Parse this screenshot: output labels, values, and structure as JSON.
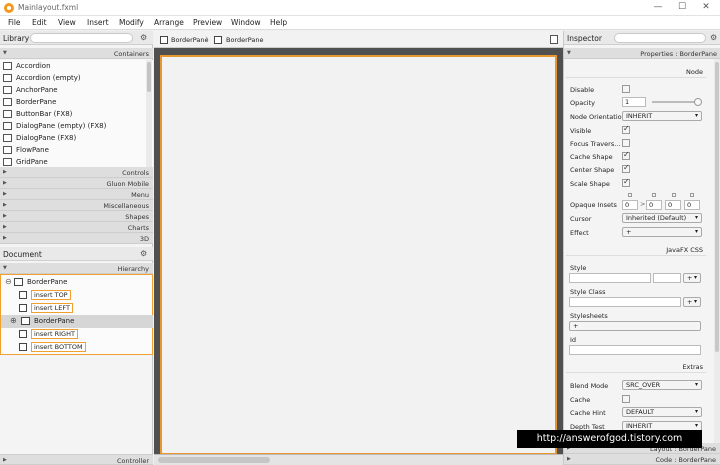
{
  "window": {
    "title": "Mainlayout.fxml",
    "minimize": "—",
    "maximize": "☐",
    "close": "✕"
  },
  "menu": [
    "File",
    "Edit",
    "View",
    "Insert",
    "Modify",
    "Arrange",
    "Preview",
    "Window",
    "Help"
  ],
  "library": {
    "title": "Library",
    "gear": "⚙",
    "containers_header": "Containers",
    "items": [
      "Accordion",
      "Accordion  (empty)",
      "AnchorPane",
      "BorderPane",
      "ButtonBar  (FX8)",
      "DialogPane (empty)  (FX8)",
      "DialogPane  (FX8)",
      "FlowPane",
      "GridPane"
    ],
    "sections": [
      "Controls",
      "Gluon Mobile",
      "Menu",
      "Miscellaneous",
      "Shapes",
      "Charts",
      "3D"
    ]
  },
  "document": {
    "title": "Document",
    "gear": "⚙",
    "hierarchy_header": "Hierarchy",
    "root": "BorderPane",
    "children": [
      "insert TOP",
      "insert LEFT",
      "BorderPane",
      "insert RIGHT",
      "insert BOTTOM"
    ],
    "controller_label": "Controller"
  },
  "breadcrumb": [
    "BorderPane",
    "BorderPane"
  ],
  "inspector": {
    "title": "Inspector",
    "properties_header": "Properties : BorderPane",
    "node_section": "Node",
    "fields": {
      "disable": "Disable",
      "opacity": "Opacity",
      "opacity_value": "1",
      "node_orientation": "Node Orientation",
      "node_orientation_value": "INHERIT",
      "visible": "Visible",
      "focus_traversable": "Focus Travers...",
      "cache_shape": "Cache Shape",
      "center_shape": "Center Shape",
      "scale_shape": "Scale Shape",
      "opaque_insets": "Opaque Insets",
      "opaque_insets_values": [
        "0",
        "0",
        "0",
        "0"
      ],
      "cursor": "Cursor",
      "cursor_value": "Inherited (Default)",
      "effect": "Effect",
      "effect_value": "+"
    },
    "css_section": "JavaFX CSS",
    "style_label": "Style",
    "style_class_label": "Style Class",
    "stylesheets_label": "Stylesheets",
    "stylesheets_add": "+",
    "id_label": "Id",
    "extras_section": "Extras",
    "blend_mode": "Blend Mode",
    "blend_mode_value": "SRC_OVER",
    "cache": "Cache",
    "cache_hint": "Cache Hint",
    "cache_hint_value": "DEFAULT",
    "depth_test": "Depth Test",
    "depth_test_value": "INHERIT",
    "layout_footer": "Layout : BorderPane",
    "code_footer": "Code : BorderPane"
  },
  "watermark": "http://answerofgod.tistory.com"
}
